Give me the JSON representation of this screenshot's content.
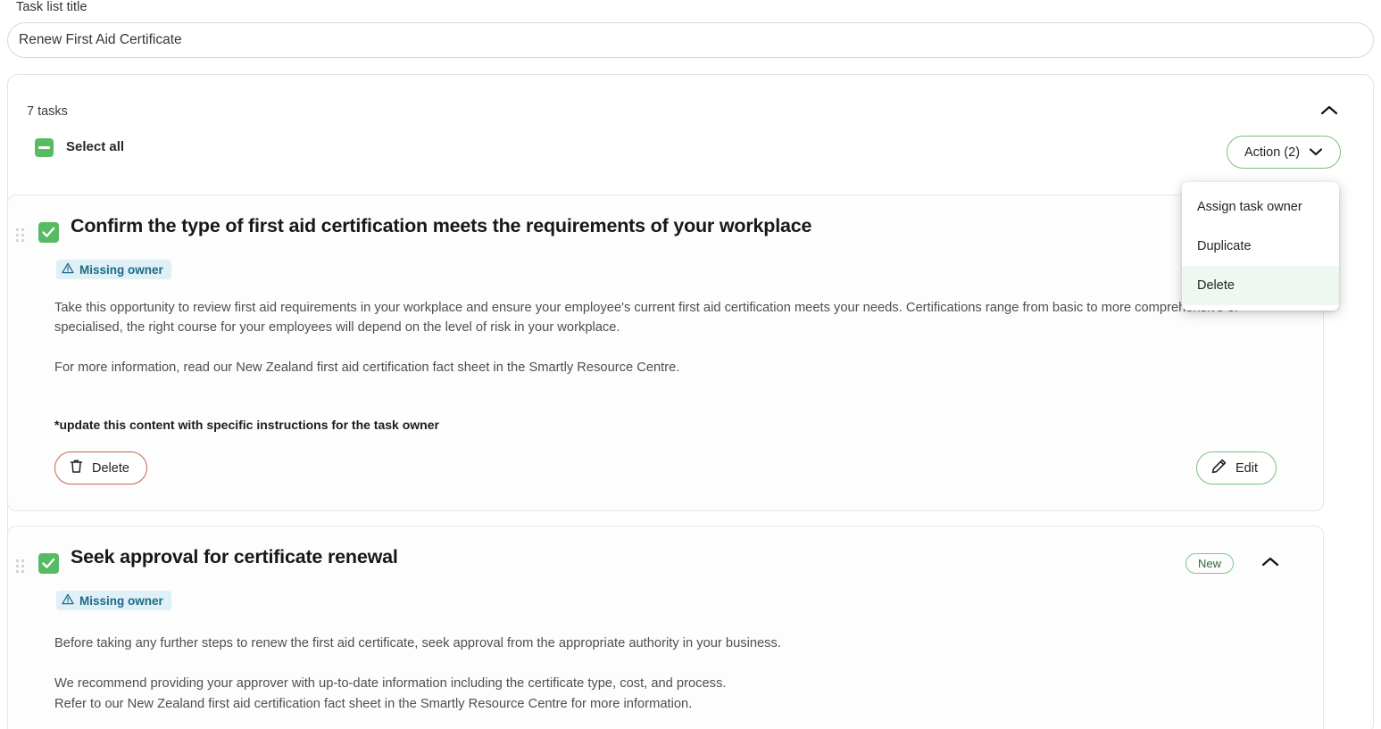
{
  "title_field": {
    "label": "Task list title",
    "value": "Renew First Aid Certificate",
    "placeholder": "Task list title"
  },
  "panel": {
    "task_count_label": "7 tasks",
    "collapse_icon": "chevron-up-icon",
    "select_all_label": "Select all",
    "select_all_state": "indeterminate"
  },
  "action_menu": {
    "button_label": "Action (2)",
    "button_icon": "chevron-down-icon",
    "open": true,
    "items": [
      {
        "label": "Assign task owner",
        "active": false
      },
      {
        "label": "Duplicate",
        "active": false
      },
      {
        "label": "Delete",
        "active": true
      }
    ]
  },
  "colors": {
    "accent_green": "#57bb63",
    "border_green": "#74c47e",
    "delete_red": "#c0654c",
    "badge_blue_bg": "#dff0f7",
    "badge_blue_text": "#1d6a86",
    "menu_hover": "#eff8f0"
  },
  "tasks": [
    {
      "title": "Confirm the type of first aid certification meets the requirements of your workplace",
      "checked": true,
      "owner_badge": "Missing owner",
      "owner_badge_icon": "warning-triangle-icon",
      "status_badge": "",
      "expanded": true,
      "paragraphs": [
        "Take this opportunity to review first aid requirements in your workplace and ensure your employee's current first aid certification meets your needs. Certifications range from basic to more comprehensive or specialised, the right course for your employees will depend on the level of risk in your workplace.",
        "For more information, read our New Zealand first aid certification fact sheet in the Smartly Resource Centre."
      ],
      "note": "*update this content with specific instructions for the task owner",
      "delete_label": "Delete",
      "delete_icon": "trash-icon",
      "edit_label": "Edit",
      "edit_icon": "pencil-icon"
    },
    {
      "title": "Seek approval for certificate renewal",
      "checked": true,
      "owner_badge": "Missing owner",
      "owner_badge_icon": "warning-triangle-icon",
      "status_badge": "New",
      "expanded": true,
      "collapse_icon": "chevron-up-icon",
      "paragraphs": [
        "Before taking any further steps to renew the first aid certificate, seek approval from the appropriate authority in your business.",
        "We recommend providing your approver with up-to-date information including the certificate type, cost, and process.",
        "Refer to our New Zealand first aid certification fact sheet in the Smartly Resource Centre for more information."
      ]
    }
  ]
}
